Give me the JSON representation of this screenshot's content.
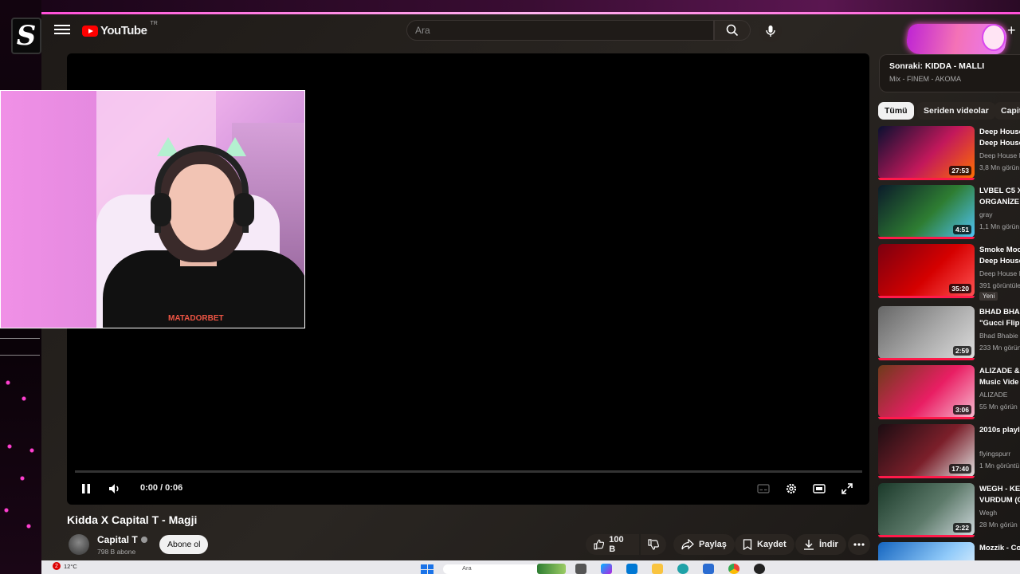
{
  "masthead": {
    "logo_word": "YouTube",
    "logo_region": "TR",
    "search_placeholder": "Ara"
  },
  "player": {
    "time": "0:00 / 0:06"
  },
  "video": {
    "title": "Kidda X Capital T - Magji",
    "channel": "Capital T",
    "subscribers": "798 B abone",
    "subscribe_label": "Abone ol",
    "like_count": "100 B",
    "share_label": "Paylaş",
    "save_label": "Kaydet",
    "download_label": "İndir"
  },
  "sidebar": {
    "up_next_title": "Sonraki: KIDDA - MALLI",
    "up_next_sub": "Mix - FINEM - AKOMA",
    "chips": [
      "Tümü",
      "Seriden videolar",
      "Capit"
    ],
    "recommendations": [
      {
        "title1": "Deep House",
        "title2": "Deep House",
        "channel": "Deep House I",
        "views": "3,8 Mn görün",
        "duration": "27:53",
        "music": true,
        "colors": [
          "#0a1030",
          "#c2185b",
          "#ff6f00"
        ]
      },
      {
        "title1": "LVBEL C5 X",
        "title2": "ORGANİZE",
        "channel": "gray",
        "views": "1,1 Mn görün",
        "duration": "4:51",
        "music": true,
        "colors": [
          "#0b1a2a",
          "#2e7d32",
          "#4fc3f7"
        ]
      },
      {
        "title1": "Smoke Moo",
        "title2": "Deep House",
        "channel": "Deep House I",
        "views": "391 görüntüle",
        "duration": "35:20",
        "badge": "Yeni",
        "colors": [
          "#7a0010",
          "#d50000",
          "#ff5252"
        ]
      },
      {
        "title1": "BHAD BHAB",
        "title2": "\"Gucci Flip",
        "channel": "Bhad Bhabie",
        "views": "233 Mn görün",
        "duration": "2:59",
        "music": true,
        "colors": [
          "#666",
          "#aaa",
          "#ddd"
        ]
      },
      {
        "title1": "ALIZADE &",
        "title2": "Music Vide",
        "channel": "ALIZADE",
        "views": "55 Mn görün",
        "duration": "3:06",
        "music": true,
        "colors": [
          "#6d3b1a",
          "#e91e63",
          "#f8bbd0"
        ]
      },
      {
        "title1": "2010s playl",
        "title2": "",
        "channel": "flyingspurr",
        "views": "1 Mn görüntü",
        "duration": "17:40",
        "colors": [
          "#1a0d12",
          "#7b1f2a",
          "#e0e0e0"
        ]
      },
      {
        "title1": "WEGH - KE",
        "title2": "VURDUM (C",
        "channel": "Wegh",
        "views": "28 Mn görün",
        "duration": "2:22",
        "music": true,
        "colors": [
          "#1b3a2a",
          "#5d7a6a",
          "#cfd8dc"
        ]
      },
      {
        "title1": "Mozzik - Co",
        "title2": "",
        "channel": "",
        "views": "",
        "duration": "",
        "colors": [
          "#1565c0",
          "#90caf9",
          "#ffffff"
        ]
      }
    ]
  },
  "taskbar": {
    "weather": "12°C",
    "notif_count": "2",
    "search_placeholder": "Ara"
  },
  "webcam": {
    "shirt_text": "MATADORBET"
  }
}
